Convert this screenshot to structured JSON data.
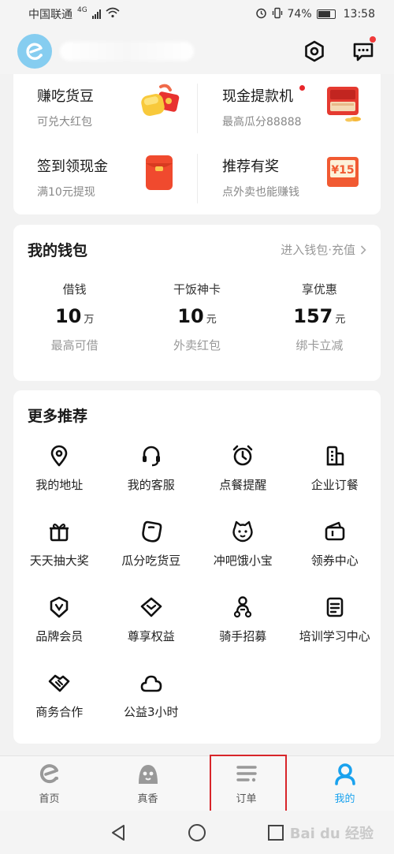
{
  "status_bar": {
    "carrier": "中国联通",
    "network": "4G",
    "battery": "74%",
    "time": "13:58"
  },
  "header": {
    "settings_icon": "hexagon-settings-icon",
    "message_icon": "chat-bubble-icon"
  },
  "promo": [
    {
      "title": "赚吃货豆",
      "subtitle": "可兑大红包",
      "icon": "coins-redpacket-icon"
    },
    {
      "title": "现金提款机",
      "subtitle": "最高瓜分88888",
      "icon": "cash-machine-icon",
      "dot": true
    },
    {
      "title": "签到领现金",
      "subtitle": "满10元提现",
      "icon": "red-envelope-icon"
    },
    {
      "title": "推荐有奖",
      "subtitle": "点外卖也能赚钱",
      "icon": "coupon-15-icon",
      "badge": "¥15"
    }
  ],
  "wallet": {
    "title": "我的钱包",
    "link": "进入钱包·充值",
    "columns": [
      {
        "label": "借钱",
        "value": "10",
        "unit": "万",
        "note": "最高可借"
      },
      {
        "label": "干饭神卡",
        "value": "10",
        "unit": "元",
        "note": "外卖红包"
      },
      {
        "label": "享优惠",
        "value": "157",
        "unit": "元",
        "note": "绑卡立减"
      }
    ]
  },
  "more": {
    "title": "更多推荐",
    "items": [
      {
        "label": "我的地址",
        "icon": "location-pin-icon"
      },
      {
        "label": "我的客服",
        "icon": "headset-icon"
      },
      {
        "label": "点餐提醒",
        "icon": "alarm-clock-icon"
      },
      {
        "label": "企业订餐",
        "icon": "building-icon"
      },
      {
        "label": "天天抽大奖",
        "icon": "gift-icon"
      },
      {
        "label": "瓜分吃货豆",
        "icon": "bean-icon"
      },
      {
        "label": "冲吧饿小宝",
        "icon": "mascot-icon"
      },
      {
        "label": "领券中心",
        "icon": "wallet-coupon-icon"
      },
      {
        "label": "品牌会员",
        "icon": "shield-v-icon"
      },
      {
        "label": "尊享权益",
        "icon": "diamond-icon"
      },
      {
        "label": "骑手招募",
        "icon": "rider-icon"
      },
      {
        "label": "培训学习中心",
        "icon": "document-icon"
      },
      {
        "label": "商务合作",
        "icon": "handshake-icon"
      },
      {
        "label": "公益3小时",
        "icon": "cloud-heart-icon"
      }
    ]
  },
  "tabbar": [
    {
      "label": "首页",
      "icon": "home-e-icon"
    },
    {
      "label": "真香",
      "icon": "mascot-head-icon"
    },
    {
      "label": "订单",
      "icon": "order-list-icon"
    },
    {
      "label": "我的",
      "icon": "profile-icon",
      "active": true
    }
  ],
  "watermark": "Bai du 经验",
  "colors": {
    "accent": "#1aa2ee",
    "highlight": "#d8252a"
  }
}
